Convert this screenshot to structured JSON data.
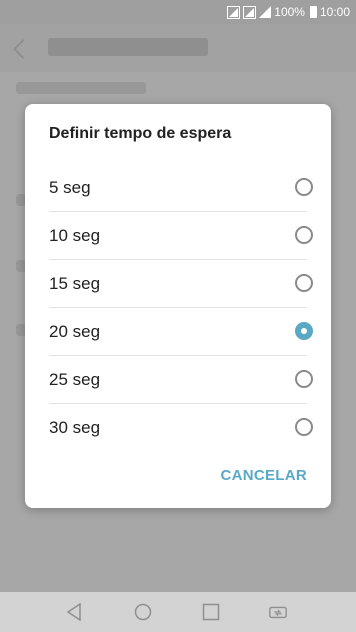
{
  "status_bar": {
    "battery": "100%",
    "time": "10:00",
    "icons": [
      "signal-sim1-icon",
      "signal-sim2-icon",
      "battery-icon"
    ]
  },
  "dialog": {
    "title": "Definir tempo de espera",
    "options": [
      {
        "label": "5 seg",
        "selected": false
      },
      {
        "label": "10 seg",
        "selected": false
      },
      {
        "label": "15 seg",
        "selected": false
      },
      {
        "label": "20 seg",
        "selected": true
      },
      {
        "label": "25 seg",
        "selected": false
      },
      {
        "label": "30 seg",
        "selected": false
      }
    ],
    "cancel_label": "CANCELAR"
  },
  "nav_bar": {
    "icons": [
      "back-icon",
      "home-icon",
      "recent-apps-icon",
      "switch-sim-icon"
    ]
  },
  "colors": {
    "accent": "#5aa9c4",
    "overlay": "#a9a9a9",
    "dialog_bg": "#ffffff"
  }
}
